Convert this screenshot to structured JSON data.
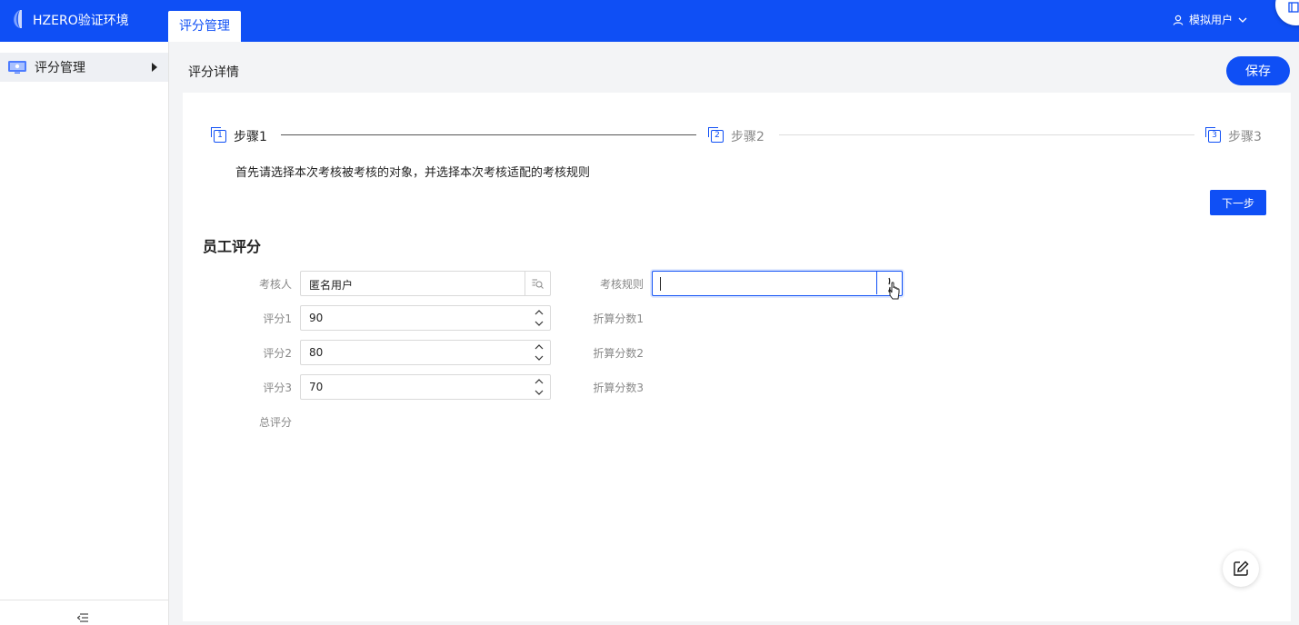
{
  "app": {
    "title": "HZERO验证环境",
    "active_tab": "评分管理",
    "user": "模拟用户"
  },
  "sidebar": {
    "items": [
      {
        "label": "评分管理"
      }
    ]
  },
  "header": {
    "title": "评分详情",
    "save_label": "保存"
  },
  "steps": {
    "items": [
      {
        "num": "1",
        "label": "步骤1",
        "status": "active"
      },
      {
        "num": "2",
        "label": "步骤2",
        "status": "wait"
      },
      {
        "num": "3",
        "label": "步骤3",
        "status": "wait"
      }
    ],
    "description": "首先请选择本次考核被考核的对象，并选择本次考核适配的考核规则",
    "next_label": "下一步"
  },
  "form": {
    "section_title": "员工评分",
    "assessor_label": "考核人",
    "assessor_value": "匿名用户",
    "rule_label": "考核规则",
    "rule_value": "",
    "score1_label": "评分1",
    "score1_value": "90",
    "score2_label": "评分2",
    "score2_value": "80",
    "score3_label": "评分3",
    "score3_value": "70",
    "converted1_label": "折算分数1",
    "converted2_label": "折算分数2",
    "converted3_label": "折算分数3",
    "total_label": "总评分"
  },
  "colors": {
    "primary": "#0f4ff5",
    "label": "#888888",
    "border": "#d9d9d9"
  }
}
